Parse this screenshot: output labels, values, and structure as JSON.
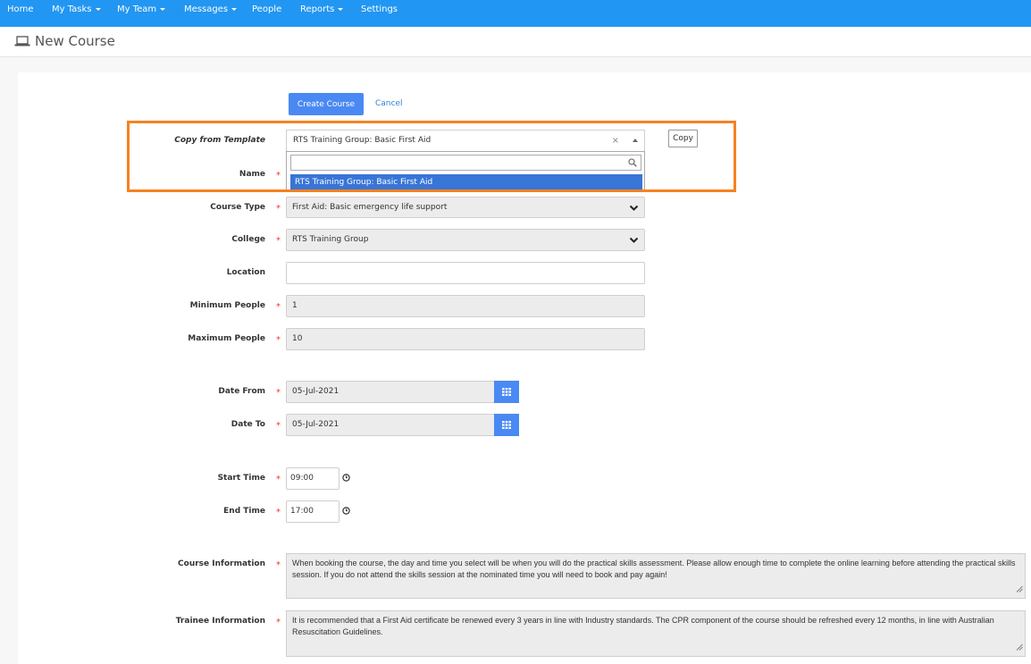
{
  "nav": {
    "home": "Home",
    "my_tasks": "My Tasks",
    "my_team": "My Team",
    "messages": "Messages",
    "people": "People",
    "reports": "Reports",
    "settings": "Settings"
  },
  "header": {
    "title": "New Course"
  },
  "actions": {
    "create": "Create Course",
    "cancel": "Cancel",
    "copy": "Copy"
  },
  "form": {
    "template": {
      "label": "Copy from Template",
      "value": "RTS Training Group: Basic First Aid",
      "clear": "×",
      "search_value": "",
      "options": [
        "RTS Training Group: Basic First Aid"
      ]
    },
    "name": {
      "label": "Name"
    },
    "course_type": {
      "label": "Course Type",
      "value": "First Aid: Basic emergency life support"
    },
    "college": {
      "label": "College",
      "value": "RTS Training Group"
    },
    "location": {
      "label": "Location",
      "value": ""
    },
    "min_people": {
      "label": "Minimum People",
      "value": "1"
    },
    "max_people": {
      "label": "Maximum People",
      "value": "10"
    },
    "date_from": {
      "label": "Date From",
      "value": "05-Jul-2021"
    },
    "date_to": {
      "label": "Date To",
      "value": "05-Jul-2021"
    },
    "start_time": {
      "label": "Start Time",
      "value": "09:00"
    },
    "end_time": {
      "label": "End Time",
      "value": "17:00"
    },
    "course_info": {
      "label": "Course Information",
      "value": "When booking the course, the day and time you select will be when you will do the practical skills assessment. Please allow enough time to complete the online learning before attending the practical skills session. If you do not attend the skills session at the nominated time you will need to book and pay again!"
    },
    "trainee_info": {
      "label": "Trainee Information",
      "value": "It is recommended that a First Aid certificate be renewed every 3 years in line with Industry standards. The CPR component of the course should be refreshed every 12 months, in line with Australian Resuscitation Guidelines."
    },
    "required_mark": "*"
  },
  "colors": {
    "nav": "#2196f3",
    "primary": "#4a89f3",
    "highlight": "#f58220",
    "option_selected": "#3875d7"
  }
}
